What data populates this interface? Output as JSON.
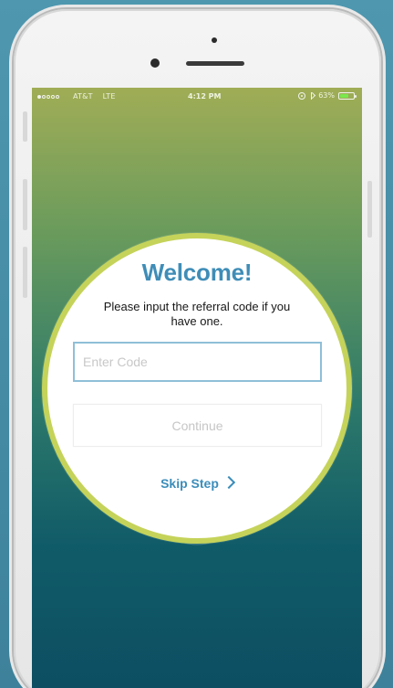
{
  "status_bar": {
    "carrier": "AT&T",
    "network": "LTE",
    "time": "4:12 PM",
    "battery_percent": "63%",
    "battery_level": 0.63
  },
  "welcome": {
    "title": "Welcome!",
    "subtitle": "Please input the referral code if you have one.",
    "input_placeholder": "Enter Code",
    "continue_label": "Continue",
    "skip_label": "Skip Step"
  },
  "colors": {
    "background": "#4f93ab",
    "accent_blue": "#3f8db7",
    "ring": "#c5d35a",
    "gradient_top": "#a0ad56",
    "gradient_bottom": "#0d4e62"
  },
  "icons": {
    "back_chevron": "chevron-right-icon",
    "bluetooth": "bluetooth-icon",
    "alarm": "alarm-icon",
    "battery": "battery-icon"
  }
}
